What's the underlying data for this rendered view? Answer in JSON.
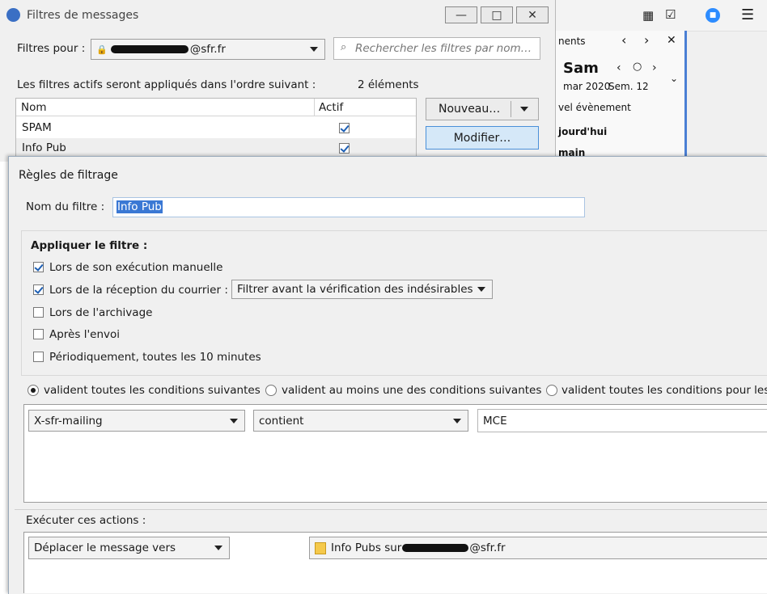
{
  "background_app": {
    "toolbar_icons": [
      "calendar-icon",
      "tasks-icon",
      "chat-icon",
      "hamburger-menu-icon"
    ],
    "panel_header": "nents",
    "calendar_day": "Sam",
    "calendar_month": "mar 2020",
    "calendar_week": "Sem. 12",
    "new_event": "vel évènement",
    "today": "jourd'hui",
    "tomorrow": "main"
  },
  "filters_window": {
    "title": "Filtres de messages",
    "filters_for_label": "Filtres pour :",
    "account_value": "@sfr.fr",
    "search_placeholder": "Rechercher les filtres par nom…",
    "order_text": "Les filtres actifs seront appliqués dans l'ordre suivant :",
    "count_text": "2 éléments",
    "columns": [
      "Nom",
      "Actif"
    ],
    "filters": [
      {
        "name": "SPAM",
        "active": true
      },
      {
        "name": "Info Pub",
        "active": true
      }
    ],
    "new_button": "Nouveau…",
    "edit_button": "Modifier…"
  },
  "rules_window": {
    "title": "Règles de filtrage",
    "filter_name_label": "Nom du filtre :",
    "filter_name_value": "Info Pub",
    "apply_header": "Appliquer le filtre :",
    "apply_options": [
      {
        "label": "Lors de son exécution manuelle",
        "checked": true
      },
      {
        "label": "Lors de la réception du courrier :",
        "checked": true
      },
      {
        "label": "Lors de l'archivage",
        "checked": false
      },
      {
        "label": "Après l'envoi",
        "checked": false
      },
      {
        "label": "Périodiquement, toutes les 10 minutes",
        "checked": false
      }
    ],
    "reception_mode": "Filtrer avant la vérification des indésirables",
    "match_options": [
      {
        "label": "valident toutes les conditions suivantes",
        "selected": true
      },
      {
        "label": "valident au moins une des conditions suivantes",
        "selected": false
      },
      {
        "label": "valident toutes les conditions pour les",
        "selected": false
      }
    ],
    "condition": {
      "field": "X-sfr-mailing",
      "operator": "contient",
      "value": "MCE"
    },
    "actions_label": "Exécuter ces actions :",
    "action": {
      "type": "Déplacer le message vers",
      "target": "Info Pubs sur",
      "target_suffix": "@sfr.fr"
    }
  }
}
